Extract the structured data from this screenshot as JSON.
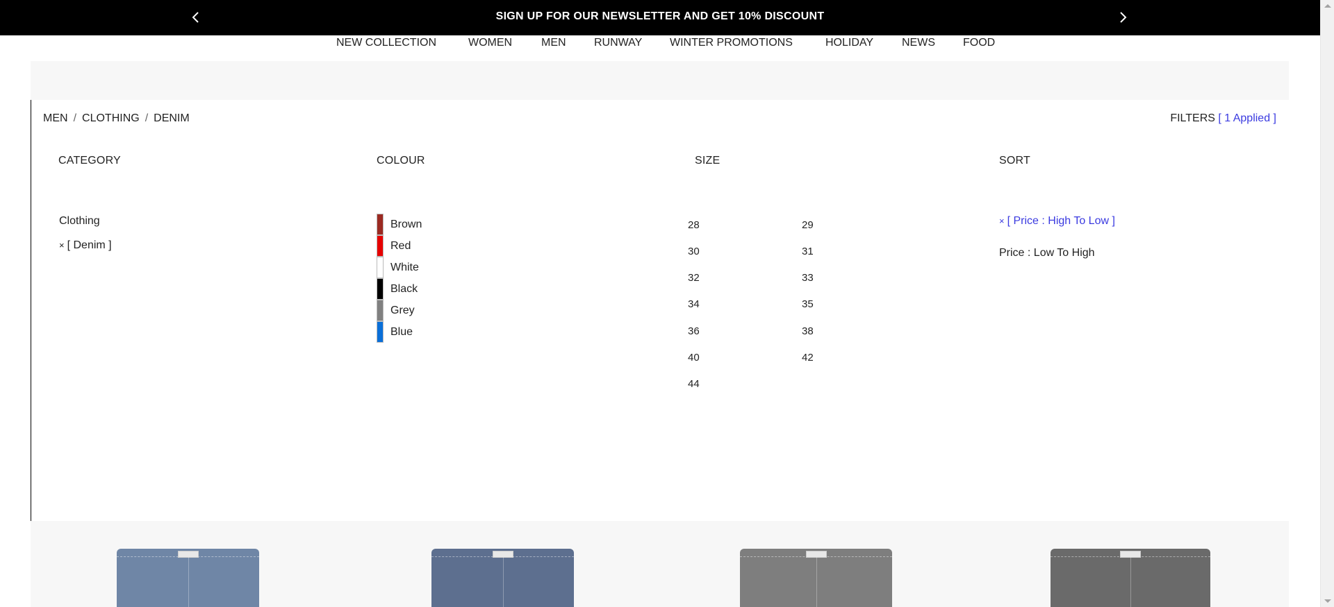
{
  "banner": {
    "text": "SIGN UP FOR OUR NEWSLETTER AND GET 10% DISCOUNT",
    "prev_icon": "chevron-left-icon",
    "next_icon": "chevron-right-icon"
  },
  "nav": {
    "items": [
      "NEW COLLECTION",
      "WOMEN",
      "MEN",
      "RUNWAY",
      "WINTER PROMOTIONS",
      "HOLIDAY",
      "NEWS",
      "FOOD"
    ]
  },
  "breadcrumb": {
    "items": [
      "MEN",
      "CLOTHING",
      "DENIM"
    ],
    "separator": "/"
  },
  "filters": {
    "label": "FILTERS",
    "applied": "[ 1 Applied ]"
  },
  "category": {
    "heading": "CATEGORY",
    "items": [
      "Clothing"
    ],
    "selected": "[ Denim ]",
    "remove_mark": "×"
  },
  "colour": {
    "heading": "COLOUR",
    "items": [
      {
        "label": "Brown",
        "color": "#9b2a22"
      },
      {
        "label": "Red",
        "color": "#e60000"
      },
      {
        "label": "White",
        "color": "#ffffff"
      },
      {
        "label": "Black",
        "color": "#000000"
      },
      {
        "label": "Grey",
        "color": "#808080"
      },
      {
        "label": "Blue",
        "color": "#0a6fd8"
      }
    ]
  },
  "size": {
    "heading": "SIZE",
    "items": [
      "28",
      "29",
      "30",
      "31",
      "32",
      "33",
      "34",
      "35",
      "36",
      "38",
      "40",
      "42",
      "44"
    ]
  },
  "sort": {
    "heading": "SORT",
    "selected": "[ Price : High To Low ]",
    "remove_mark": "×",
    "options": [
      "Price : Low To High"
    ]
  },
  "colors": {
    "accent_blue": "#3a3ae0",
    "banner_bg": "#000000",
    "panel_bg": "#f7f7f7"
  },
  "products": [
    {
      "tone": "#6f86a6"
    },
    {
      "tone": "#5d6f8f"
    },
    {
      "tone": "#7e7e7e"
    },
    {
      "tone": "#6a6a6a"
    }
  ]
}
